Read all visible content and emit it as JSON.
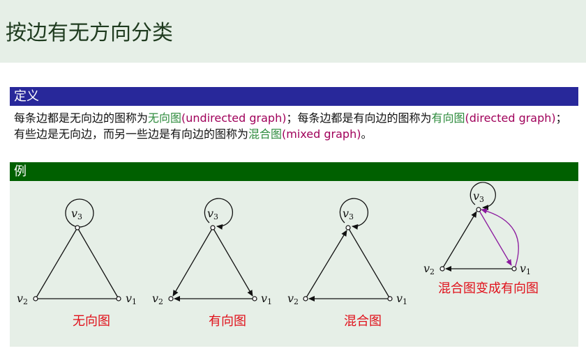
{
  "title": "按边有无方向分类",
  "definition": {
    "header": "定义",
    "seg1": "每条边都是无向边的图称为",
    "term1": "无向图",
    "eng1": "(undirected graph)",
    "seg2": "；每条边都是有向边的图称为",
    "term2": "有向图",
    "eng2": "(directed graph)",
    "seg3": "；有些边是无向边，而另一些边是有向边的图称为",
    "term3": "混合图",
    "eng3": "(mixed graph)",
    "seg4": "。"
  },
  "example": {
    "header": "例",
    "captions": [
      "无向图",
      "有向图",
      "混合图",
      "混合图变成有向图"
    ],
    "vertex_labels": {
      "v1": "v",
      "v2": "v",
      "v3": "v",
      "sub1": "1",
      "sub2": "2",
      "sub3": "3"
    }
  },
  "colors": {
    "definition_header": "#28289a",
    "example_header": "#006000",
    "term": "#2e8b3d",
    "english": "#a0005a",
    "caption": "#e0101a",
    "purple_edge": "#8b1a9e"
  }
}
